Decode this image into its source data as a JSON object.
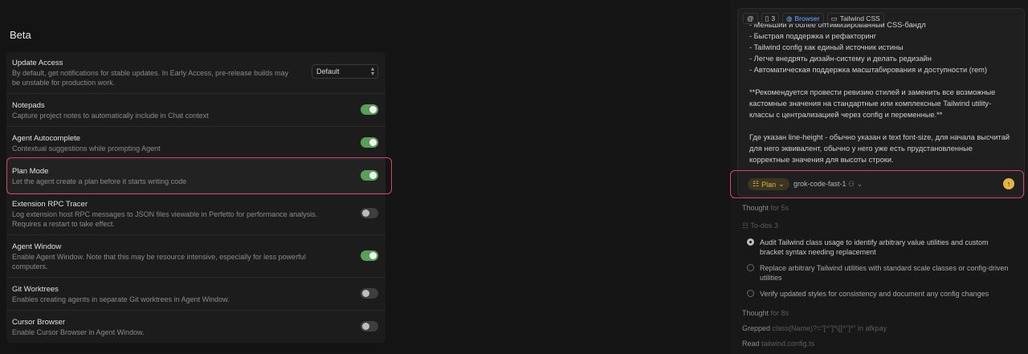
{
  "settings": {
    "section_title": "Beta",
    "update_access": {
      "title": "Update Access",
      "desc_lines": [
        "By default, get notifications for stable updates. In Early Access, pre-release builds may",
        "be unstable for production work."
      ],
      "select_value": "Default"
    },
    "notepads": {
      "title": "Notepads",
      "desc": "Capture project notes to automatically include in Chat context",
      "enabled": true
    },
    "agent_autocomplete": {
      "title": "Agent Autocomplete",
      "desc": "Contextual suggestions while prompting Agent",
      "enabled": true
    },
    "plan_mode": {
      "title": "Plan Mode",
      "desc": "Let the agent create a plan before it starts writing code",
      "enabled": true
    },
    "rpc_tracer": {
      "title": "Extension RPC Tracer",
      "desc_lines": [
        "Log extension host RPC messages to JSON files viewable in Perfetto for performance analysis.",
        "Requires a restart to take effect."
      ],
      "enabled": false
    },
    "agent_window": {
      "title": "Agent Window",
      "desc_lines": [
        "Enable Agent Window. Note that this may be resource intensive, especially for less powerful",
        "computers."
      ],
      "enabled": true
    },
    "git_worktrees": {
      "title": "Git Worktrees",
      "desc": "Enables creating agents in separate Git worktrees in Agent Window.",
      "enabled": false
    },
    "cursor_browser": {
      "title": "Cursor Browser",
      "desc": "Enable Cursor Browser in Agent Window.",
      "enabled": false
    }
  },
  "chat": {
    "chips": {
      "at": "@",
      "count": "3",
      "browser": "Browser",
      "tailwind": "Tailwind CSS"
    },
    "lines": [
      "- Меньший и более оптимизированный CSS-бандл",
      "- Быстрая поддержка и рефакторинг",
      "- Tailwind config как единый источник истины",
      "- Легче внедрять дизайн-систему и делать редизайн",
      "- Автоматическая поддержка масштабирования и доступности (rem)",
      "",
      "**Рекомендуется провести ревизию стилей и заменить все возможные",
      "кастомные значения на стандартные или комплексные Tailwind utility-",
      "классы с централизацией через config и переменные.**",
      "",
      "Где указан line-height - обычно указан и text font-size, для начала высчитай",
      "для него эквивалент, обычно у него уже есть прудстановленные",
      "корректные значения для высоты строки."
    ],
    "mode_label": "Plan",
    "model_label": "grok-code-fast-1",
    "activity": {
      "thought1_label": "Thought",
      "thought1_time": "for 5s",
      "todos_label": "To-dos",
      "todos_count": "3",
      "todos": [
        {
          "text_lines": [
            "Audit Tailwind class usage to identify arbitrary value utilities and custom",
            "bracket syntax needing replacement"
          ],
          "active": true
        },
        {
          "text_lines": [
            "Replace arbitrary Tailwind utilities with standard scale classes or config-driven",
            "utilities"
          ],
          "active": false
        },
        {
          "text_lines": [
            "Verify updated styles for consistency and document any config changes"
          ],
          "active": false
        }
      ],
      "thought2_label": "Thought",
      "thought2_time": "for 8s",
      "grepped_label": "Grepped",
      "grepped_query": "class(Name)?=\"[^\"]*\\[[^\"]*\" in afkpay",
      "read_label": "Read",
      "read_file": "tailwind.config.ts"
    }
  }
}
